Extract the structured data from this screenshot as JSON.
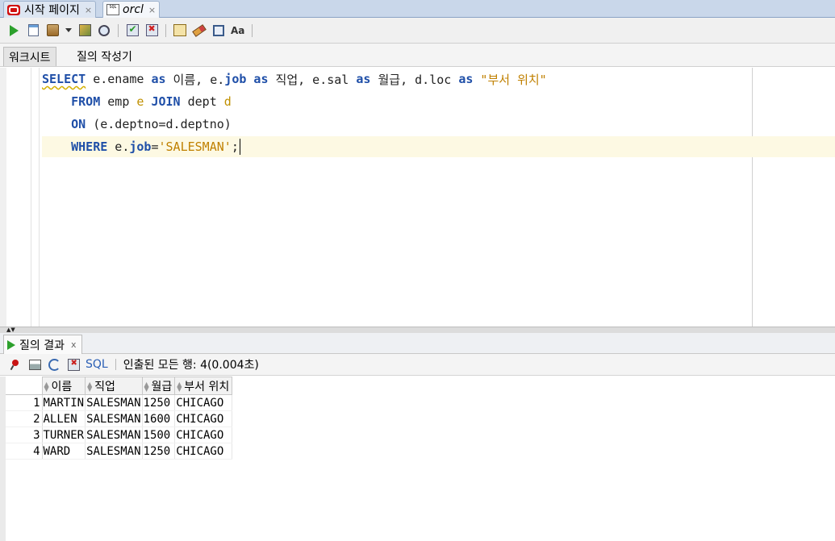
{
  "doc_tabs": [
    {
      "label": "시작 페이지",
      "close": "×"
    },
    {
      "label": "orcl",
      "close": "×"
    }
  ],
  "toolbar": {
    "icons": [
      "run-statement-icon",
      "run-script-icon",
      "commit-icon",
      "dropdown-caret-icon",
      "autotrace-icon",
      "explain-plan-icon",
      "validate-icon",
      "rollback-icon",
      "sql-tuning-icon",
      "clear-icon",
      "unshared-worksheet-icon",
      "format-case-icon"
    ],
    "case_label": "Aa"
  },
  "worksheet_tabs": {
    "active": "워크시트",
    "other": "질의 작성기"
  },
  "editor": {
    "line1": {
      "kw_select": "SELECT",
      "t1": " e.ename ",
      "kw_as1": "as",
      "t2": " 이름, e.",
      "kw_job": "job",
      "t3": " ",
      "kw_as2": "as",
      "t4": " 직업, e.sal ",
      "kw_as3": "as",
      "t5": " 월급, d.loc ",
      "kw_as4": "as",
      "t6": " ",
      "str_loc": "\"부서 위치\""
    },
    "line2": {
      "indent": "    ",
      "kw_from": "FROM",
      "t1": " emp ",
      "alias_e": "e",
      "t2": " ",
      "kw_join": "JOIN",
      "t3": " dept ",
      "alias_d": "d"
    },
    "line3": {
      "indent": "    ",
      "kw_on": "ON",
      "t1": " (e.deptno=d.deptno)"
    },
    "line4": {
      "indent": "    ",
      "kw_where": "WHERE",
      "t1": " e.",
      "kw_job": "job",
      "t2": "=",
      "str_val": "'SALESMAN'",
      "t3": ";"
    }
  },
  "results": {
    "tab_label": "질의 결과",
    "tab_close": "x",
    "sql_link": "SQL",
    "status": "인출된 모든 행: 4(0.004초)",
    "columns": [
      "이름",
      "직업",
      "월급",
      "부서 위치"
    ],
    "rows": [
      {
        "n": "1",
        "ename": "MARTIN",
        "job": "SALESMAN",
        "sal": "1250",
        "loc": "CHICAGO"
      },
      {
        "n": "2",
        "ename": "ALLEN",
        "job": "SALESMAN",
        "sal": "1600",
        "loc": "CHICAGO"
      },
      {
        "n": "3",
        "ename": "TURNER",
        "job": "SALESMAN",
        "sal": "1500",
        "loc": "CHICAGO"
      },
      {
        "n": "4",
        "ename": "WARD",
        "job": "SALESMAN",
        "sal": "1250",
        "loc": "CHICAGO"
      }
    ]
  },
  "colors": {
    "keyword": "#1f4fa8",
    "string": "#c08000",
    "current_line": "#fdf9e3",
    "tab_bar": "#c9d7ea"
  }
}
